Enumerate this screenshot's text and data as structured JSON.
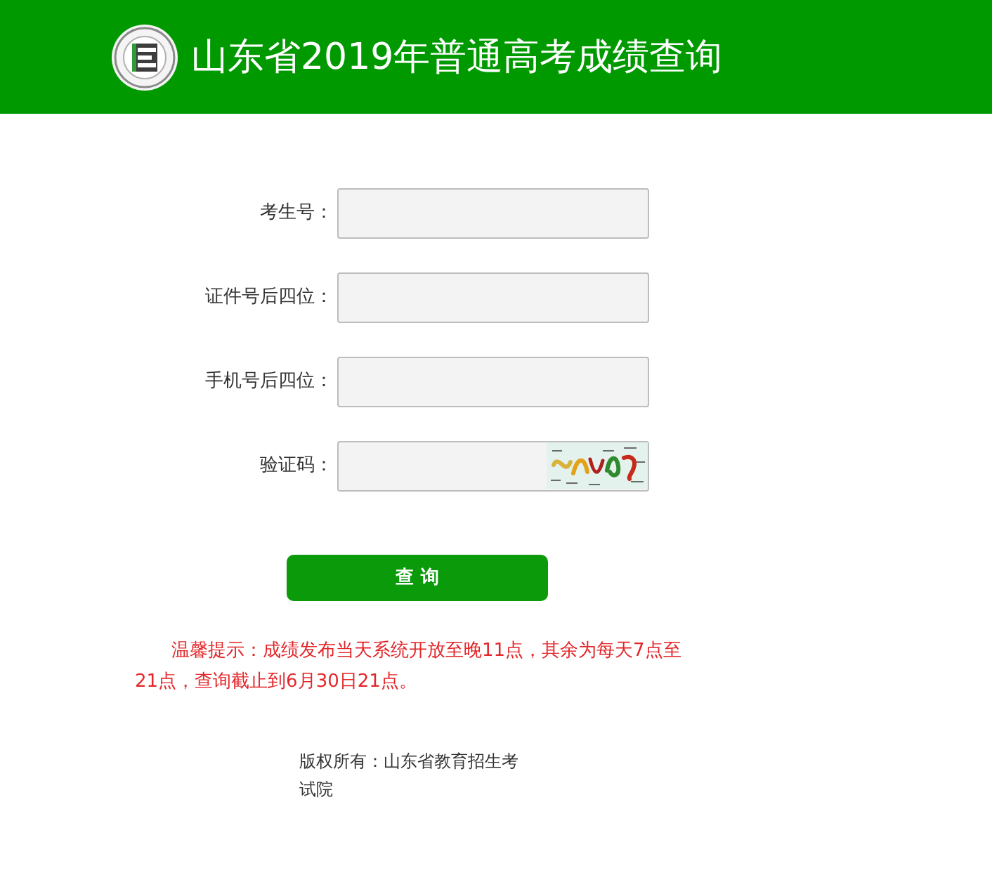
{
  "header": {
    "title": "山东省2019年普通高考成绩查询"
  },
  "form": {
    "fields": [
      {
        "kind": "text",
        "label": "考生号："
      },
      {
        "kind": "text",
        "label": "证件号后四位："
      },
      {
        "kind": "text",
        "label": "手机号后四位："
      },
      {
        "kind": "captcha",
        "label": "验证码："
      }
    ],
    "submit": "查询"
  },
  "notice": "温馨提示：成绩发布当天系统开放至晚11点，其余为每天7点至21点，查询截止到6月30日21点。",
  "footer": {
    "copyright": "版权所有：山东省教育招生考试院"
  }
}
